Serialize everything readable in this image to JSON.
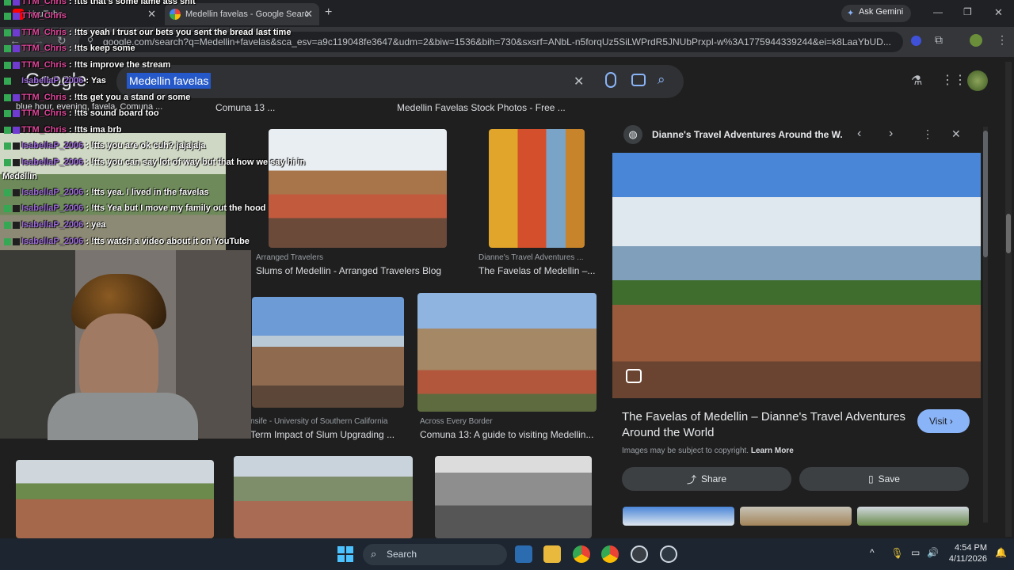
{
  "browser": {
    "tabs": [
      {
        "label": "YouTube"
      },
      {
        "label": "Medellin favelas - Google Searc"
      }
    ],
    "ask_gemini": "Ask Gemini",
    "url": "google.com/search?q=Medellin+favelas&sca_esv=a9c119048fe3647&udm=2&biw=1536&bih=730&sxsrf=ANbL-n5forqUz5SiLWPrdR5JNUbPrxpI-w%3A1775944339244&ei=k8LaaYbUD..."
  },
  "google": {
    "logo": "Google",
    "query": "Medellin favelas",
    "top_captions": [
      "blue hour, evening, favela, Comuna ...",
      "Comuna 13 ...",
      "Medellin Favelas Stock Photos - Free ..."
    ],
    "results": [
      {
        "source": "Arranged Travelers",
        "title": "Slums of Medellin - Arranged Travelers Blog"
      },
      {
        "source": "Dianne's Travel Adventures ...",
        "title": "The Favelas of Medellin –..."
      },
      {
        "source": "nsife - University of Southern California",
        "title": "Term Impact of Slum Upgrading ..."
      },
      {
        "source": "Across Every Border",
        "title": "Comuna 13: A guide to visiting Medellin..."
      }
    ]
  },
  "panel": {
    "site": "Dianne's Travel Adventures Around the W...",
    "title": "The Favelas of Medellin – Dianne's Travel Adventures Around the World",
    "visit": "Visit",
    "copyright": "Images may be subject to copyright.",
    "learn_more": "Learn More",
    "share": "Share",
    "save": "Save"
  },
  "chat": [
    {
      "user": "TTM_Chris",
      "msg": " : !tts that's some lame ass shit",
      "color": "#e0469b"
    },
    {
      "user": "TTM_Chris",
      "msg": "",
      "color": "#e0469b"
    },
    {
      "user": "TTM_Chris",
      "msg": " : !tts yeah I trust our bets you sent the bread last time",
      "color": "#e0469b"
    },
    {
      "user": "TTM_Chris",
      "msg": " : !tts keep some",
      "color": "#e0469b"
    },
    {
      "user": "TTM_Chris",
      "msg": " : !tts improve the stream",
      "color": "#e0469b"
    },
    {
      "user": "IsabellaP_2006",
      "msg": " : Yas",
      "color": "#9b6bd6"
    },
    {
      "user": "TTM_Chris",
      "msg": " : !tts get you a stand or some",
      "color": "#e0469b"
    },
    {
      "user": "TTM_Chris",
      "msg": " : !tts sound board too",
      "color": "#e0469b"
    },
    {
      "user": "TTM_Chris",
      "msg": " : !tts ima brb",
      "color": "#e0469b"
    },
    {
      "user": "IsabellaP_2006",
      "msg": " : !tts you are ok cuh? jajajaja",
      "color": "#9b6bd6"
    },
    {
      "user": "IsabellaP_2006",
      "msg": " : !tts you can say lot of way but that how we say hi in",
      "color": "#9b6bd6"
    },
    {
      "user": "",
      "msg": "Medellin",
      "color": "#ffffff"
    },
    {
      "user": "IsabellaP_2006",
      "msg": " : !tts yea. I lived in the favelas",
      "color": "#9b6bd6"
    },
    {
      "user": "IsabellaP_2006",
      "msg": " : !tts Yea but I move my family out the hood",
      "color": "#9b6bd6"
    },
    {
      "user": "IsabellaP_2006",
      "msg": " : yea",
      "color": "#9b6bd6"
    },
    {
      "user": "IsabellaP_2006",
      "msg": " : !tts watch a video about it on YouTube",
      "color": "#9b6bd6"
    }
  ],
  "taskbar": {
    "search": "Search",
    "time": "4:54 PM",
    "date": "4/11/2026"
  }
}
